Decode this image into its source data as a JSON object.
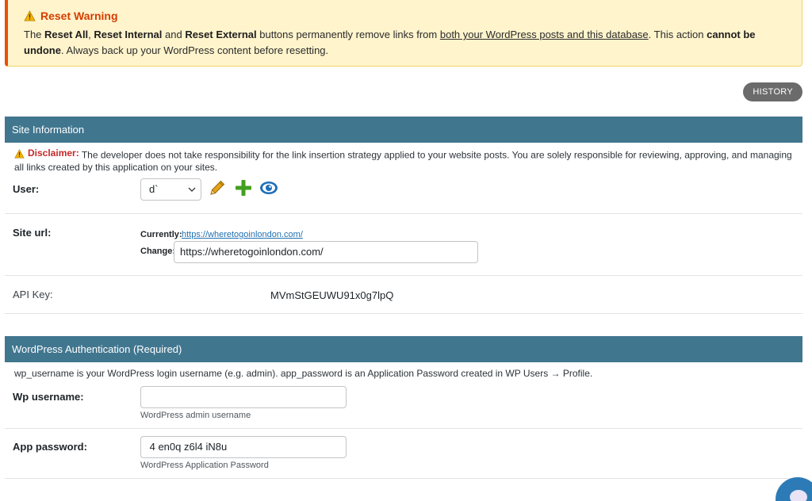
{
  "warning": {
    "title": "Reset Warning",
    "body_prefix": "The ",
    "reset_all": "Reset All",
    "sep1": ", ",
    "reset_internal": "Reset Internal",
    "and": " and ",
    "reset_external": "Reset External",
    "mid": " buttons permanently remove links from ",
    "underlined": "both your WordPress posts and this database",
    "after": ". This action ",
    "cannot": "cannot be undone",
    "end": ". Always back up your WordPress content before resetting."
  },
  "history_button": "HISTORY",
  "site_info": {
    "header": "Site Information",
    "disclaimer_label": "Disclaimer:",
    "disclaimer_text": " The developer does not take responsibility for the link insertion strategy applied to your website posts. You are solely responsible for reviewing, approving, and managing all links created by this application on your sites.",
    "user_label": "User:",
    "user_selected": "d`",
    "site_url_label": "Site url:",
    "currently_label": "Currently:",
    "currently_value": "https://wheretogoinlondon.com/",
    "change_label": "Change:",
    "change_value": "https://wheretogoinlondon.com/",
    "api_key_label": "API Key:",
    "api_key_value": "MVmStGEUWU91x0g7lpQ"
  },
  "wp_auth": {
    "header": "WordPress Authentication (Required)",
    "description": "wp_username is your WordPress login username (e.g. admin). app_password is an Application Password created in WP Users → Profile.",
    "username_label": "Wp username:",
    "username_value": "",
    "username_hint": "WordPress admin username",
    "password_label": "App password:",
    "password_value": " 4 en0q z6l4 iN8u",
    "password_hint": "WordPress Application Password"
  },
  "colors": {
    "section_header": "#41768f",
    "warning_bg": "#fff4cc",
    "warning_accent": "#e65100",
    "link": "#2271b1"
  },
  "icons": [
    "warning-icon",
    "chevron-down-icon",
    "pencil-icon",
    "plus-icon",
    "eye-icon",
    "chat-icon"
  ]
}
